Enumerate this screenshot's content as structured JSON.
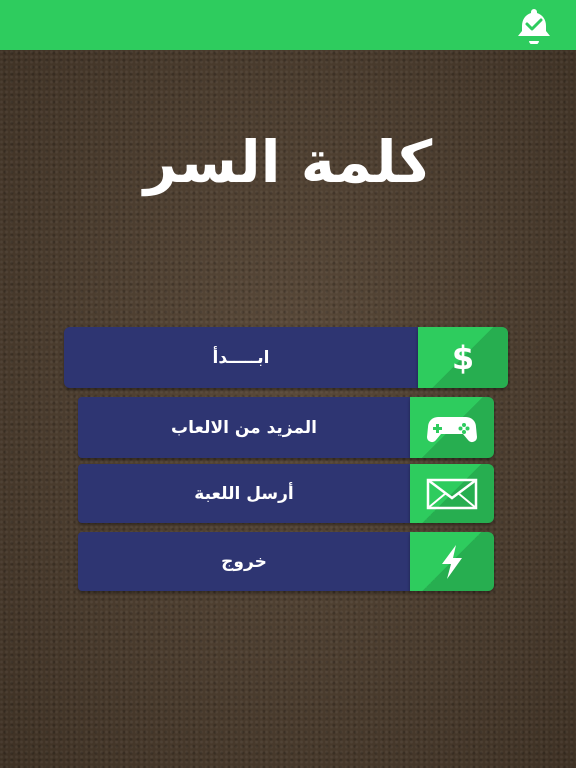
{
  "top_bar": {
    "icon": "bell-check-icon",
    "color": "#2ecc5e"
  },
  "title": "كلمة السر",
  "menu": [
    {
      "label": "ابـــــدأ",
      "icon": "dollar-icon"
    },
    {
      "label": "المزيد من الالعاب",
      "icon": "gamepad-icon"
    },
    {
      "label": "أرسل اللعبة",
      "icon": "envelope-icon"
    },
    {
      "label": "خروج",
      "icon": "lightning-icon"
    }
  ],
  "colors": {
    "button_bg": "#2e3572",
    "icon_bg": "#2ecc5e",
    "background": "#4a3c2e"
  }
}
